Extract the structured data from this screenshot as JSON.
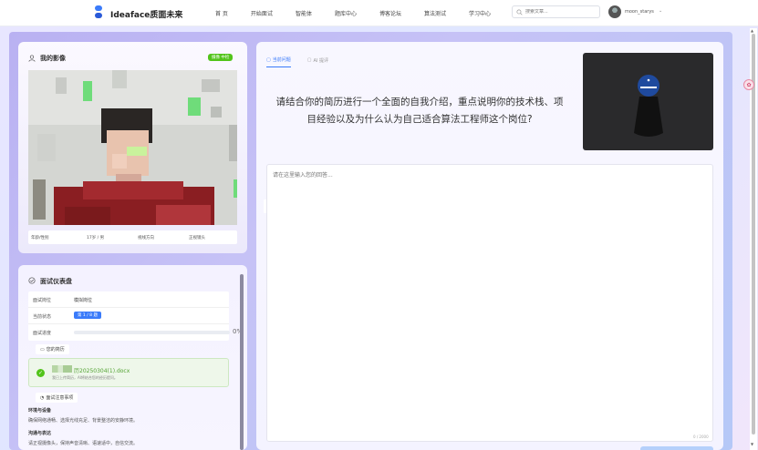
{
  "app": {
    "brand": "Ideaface质面未来",
    "nav": [
      "首 页",
      "开始面试",
      "智能体",
      "题库中心",
      "博客论坛",
      "算法测试",
      "学习中心"
    ],
    "search_placeholder": "搜索文章...",
    "username": "moon_starys"
  },
  "camera_card": {
    "title": "我的影像",
    "badge": "摄像 中检",
    "info": [
      "年龄/性别",
      "17岁 / 男",
      "视线方向",
      "正视镜头"
    ]
  },
  "dashboard": {
    "title": "面试仪表盘",
    "rows": {
      "position_label": "面试岗位",
      "position_value": "模拟岗位",
      "status_label": "当前状态",
      "status_value": "第 1 / 8 题",
      "progress_label": "面试进度",
      "progress_pct": "0%",
      "progress_value": 0
    },
    "resume_tag": "您的简历",
    "resume_file": "历20250304(1).docx",
    "resume_sub": "我已上传简历，AI将结合您的经历提问。",
    "notes_tag": "面试注意事项",
    "notes": [
      {
        "h": "环境与设备",
        "p": "确保网络通畅、选择光线充足、背景整洁的安静环境。"
      },
      {
        "h": "沟通与表达",
        "p": "请正视摄像头，保持声音清晰、语速适中，自信交流。"
      }
    ]
  },
  "interview": {
    "tabs": [
      "当前问题",
      "AI 提评"
    ],
    "question": "请结合你的简历进行一个全面的自我介绍，重点说明你的技术栈、项目经验以及为什么认为自己适合算法工程师这个岗位?",
    "answer_placeholder": "请在这里输入您的回答...",
    "counter": "0 / 2000"
  },
  "colors": {
    "accent": "#3a7bfa",
    "success": "#52c41a",
    "frame": "#b9b1f2"
  }
}
